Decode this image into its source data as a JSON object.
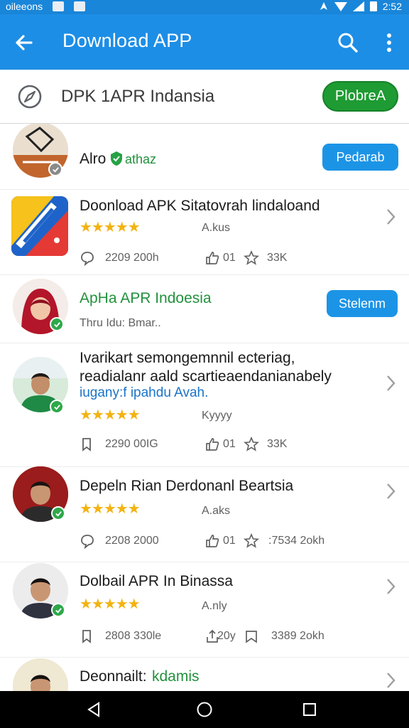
{
  "status_bar": {
    "left_text": "oileeons",
    "time": "2:52"
  },
  "app_bar": {
    "title": "Download APP"
  },
  "search_bar": {
    "text": "DPK 1APR Indansia",
    "button_label": "PlobreA"
  },
  "colors": {
    "primary": "#1d8ee6",
    "accent_green": "#1e9b32",
    "star": "#f3b310"
  },
  "list": {
    "items": [
      {
        "title": "Alro",
        "verified_label": "athaz",
        "button": "Pedarab"
      },
      {
        "title": "Doonload APK Sitatovrah lindaloand",
        "rating": 5,
        "tag": "A.kus",
        "stat1": "2209 200h",
        "stat2": "01",
        "stat3": "33K"
      },
      {
        "title": "ApHa APR Indoesia",
        "subtitle": "Thru Idu: Bmar..",
        "button": "Stelenm"
      },
      {
        "title_lines": [
          "Ivarikart semongemnnil ecteriag,",
          "readialanr aald scartieaendanianabely"
        ],
        "title_link": "iugany:f ipahdu Avah.",
        "rating": 5,
        "tag": "Kyyyy",
        "stat1": "2290 00IG",
        "stat2": "01",
        "stat3": "33K"
      },
      {
        "title": "Depeln Rian Derdonanl Beartsia",
        "rating": 5,
        "tag": "A.aks",
        "stat1": "2208 2000",
        "stat2": "01",
        "stat3": ":7534 2okh"
      },
      {
        "title": "Dolbail APR In Binassa",
        "rating": 5,
        "tag": "A.nly",
        "stat1": "2808 330le",
        "stat2": "20y",
        "stat3": "3389 2okh"
      },
      {
        "title": "Deonnailt:",
        "title_green": "kdamis"
      }
    ]
  }
}
